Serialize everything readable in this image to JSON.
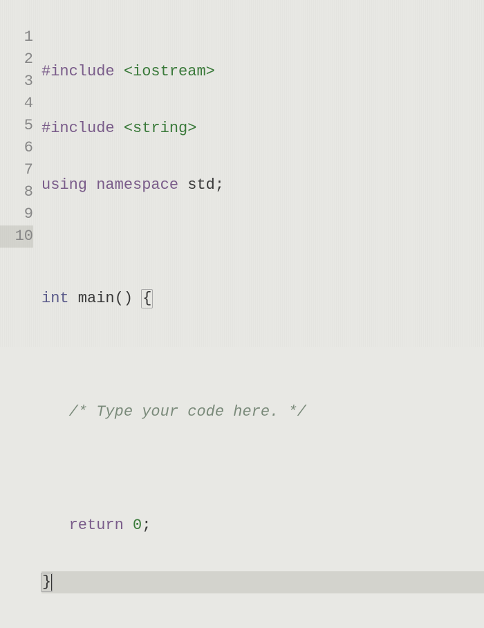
{
  "editor": {
    "language": "cpp",
    "lineCount": 10,
    "lines": [
      {
        "num": "1",
        "tokens": [
          {
            "cls": "kw-preproc",
            "text": "#include"
          },
          {
            "cls": "kw-plain",
            "text": " "
          },
          {
            "cls": "kw-include",
            "text": "<iostream>"
          }
        ]
      },
      {
        "num": "2",
        "tokens": [
          {
            "cls": "kw-preproc",
            "text": "#include"
          },
          {
            "cls": "kw-plain",
            "text": " "
          },
          {
            "cls": "kw-include",
            "text": "<string>"
          }
        ]
      },
      {
        "num": "3",
        "tokens": [
          {
            "cls": "kw-keyword",
            "text": "using"
          },
          {
            "cls": "kw-plain",
            "text": " "
          },
          {
            "cls": "kw-keyword",
            "text": "namespace"
          },
          {
            "cls": "kw-plain",
            "text": " std;"
          }
        ]
      },
      {
        "num": "4",
        "tokens": []
      },
      {
        "num": "5",
        "tokens": [
          {
            "cls": "kw-type",
            "text": "int"
          },
          {
            "cls": "kw-plain",
            "text": " main() "
          },
          {
            "cls": "bracket-focus",
            "text": "{"
          }
        ]
      },
      {
        "num": "6",
        "tokens": []
      },
      {
        "num": "7",
        "tokens": [
          {
            "cls": "kw-plain",
            "text": "   "
          },
          {
            "cls": "kw-comment",
            "text": "/* Type your code here. */"
          }
        ]
      },
      {
        "num": "8",
        "tokens": []
      },
      {
        "num": "9",
        "tokens": [
          {
            "cls": "kw-plain",
            "text": "   "
          },
          {
            "cls": "kw-keyword",
            "text": "return"
          },
          {
            "cls": "kw-plain",
            "text": " "
          },
          {
            "cls": "kw-number",
            "text": "0"
          },
          {
            "cls": "kw-plain",
            "text": ";"
          }
        ]
      },
      {
        "num": "10",
        "tokens": [
          {
            "cls": "bracket-focus",
            "text": "}"
          }
        ],
        "active": true
      }
    ]
  }
}
